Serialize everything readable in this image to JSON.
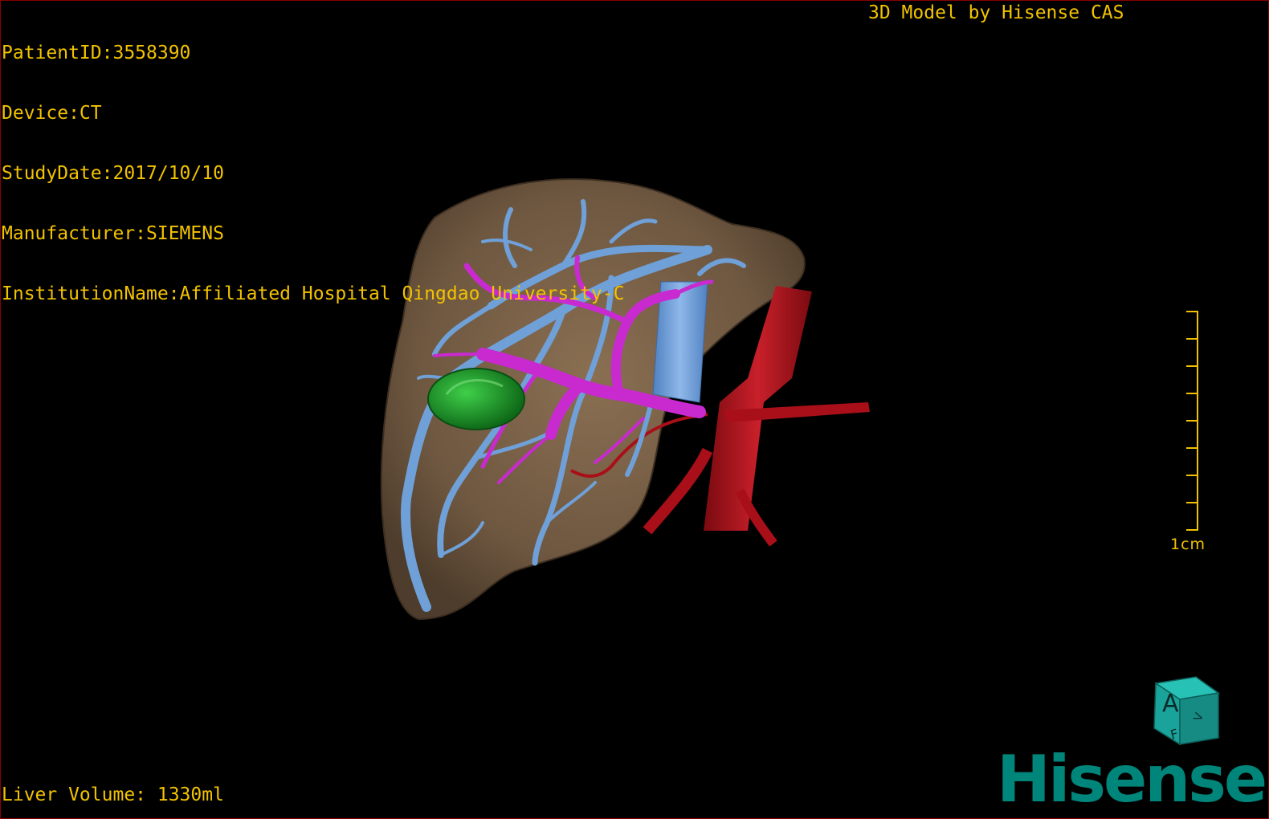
{
  "patient_info": {
    "patient_id": "PatientID:3558390",
    "device": "Device:CT",
    "study_date": "StudyDate:2017/10/10",
    "manufacturer": "Manufacturer:SIEMENS",
    "institution": "InstitutionName:Affiliated Hospital Qingdao University-C"
  },
  "header_right": "3D Model by Hisense CAS",
  "footer": {
    "liver_volume": "Liver Volume: 1330ml"
  },
  "scale_bar": {
    "label": "1cm"
  },
  "orientation_cube": {
    "front_letter": "A",
    "bottom_letter": "F",
    "side_letter": "V"
  },
  "logo": {
    "text": "Hisense"
  },
  "colors": {
    "overlay_text": "#f2c200",
    "liver": "#7a6248",
    "hepatic_vein": "#6fa0d8",
    "portal_vein": "#c82ad0",
    "artery_vena_cava": "#b5101a",
    "lesion": "#1f9a2a",
    "logo": "#00857a",
    "cube": "#1aa39a"
  }
}
